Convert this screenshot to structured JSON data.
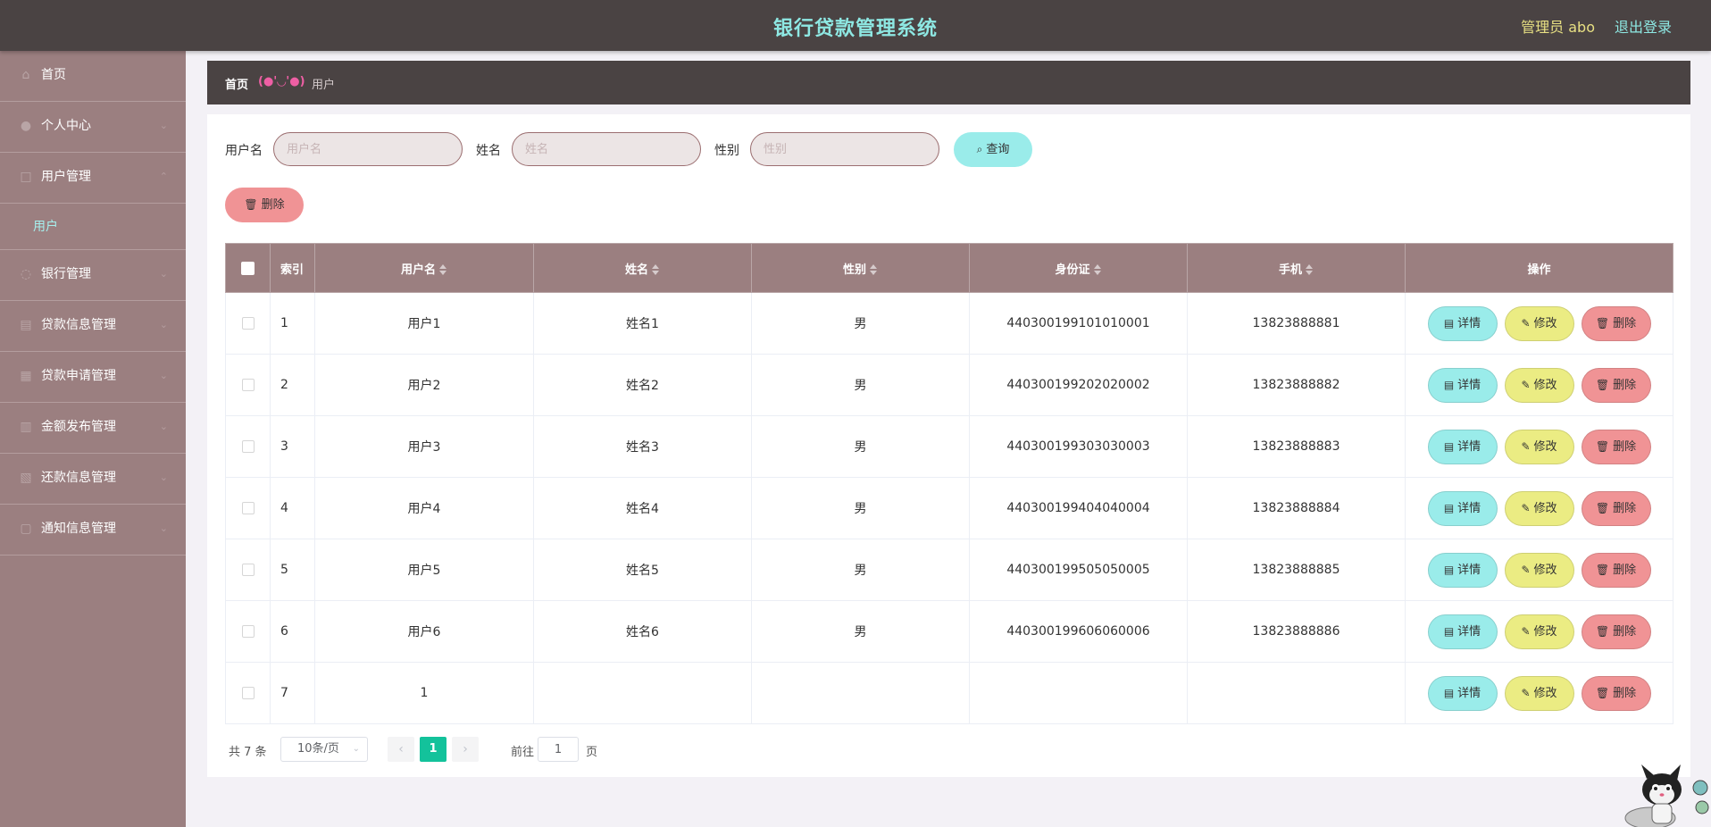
{
  "header": {
    "title": "银行贷款管理系统",
    "admin_label": "管理员 abo",
    "logout_label": "退出登录"
  },
  "sidebar": {
    "items": [
      {
        "label": "首页",
        "icon": "home-icon",
        "expandable": false
      },
      {
        "label": "个人中心",
        "icon": "user-icon",
        "expandable": true
      },
      {
        "label": "用户管理",
        "icon": "users-icon",
        "expandable": true
      },
      {
        "label": "银行管理",
        "icon": "bank-icon",
        "expandable": true
      },
      {
        "label": "贷款信息管理",
        "icon": "document-icon",
        "expandable": true
      },
      {
        "label": "贷款申请管理",
        "icon": "application-icon",
        "expandable": true
      },
      {
        "label": "金额发布管理",
        "icon": "money-icon",
        "expandable": true
      },
      {
        "label": "还款信息管理",
        "icon": "repayment-icon",
        "expandable": true
      },
      {
        "label": "通知信息管理",
        "icon": "notice-icon",
        "expandable": true
      }
    ],
    "submenu": {
      "label": "用户"
    }
  },
  "breadcrumb": {
    "home": "首页",
    "separator": "(●'◡'●)",
    "current": "用户"
  },
  "filters": [
    {
      "label": "用户名",
      "placeholder": "用户名",
      "value": ""
    },
    {
      "label": "姓名",
      "placeholder": "姓名",
      "value": ""
    },
    {
      "label": "性别",
      "placeholder": "性别",
      "value": ""
    }
  ],
  "buttons": {
    "query": "查询",
    "bulk_delete": "删除"
  },
  "table": {
    "columns": [
      "索引",
      "用户名",
      "姓名",
      "性别",
      "身份证",
      "手机",
      "操作"
    ],
    "rows": [
      {
        "index": "1",
        "username": "用户1",
        "name": "姓名1",
        "gender": "男",
        "id_card": "440300199101010001",
        "phone": "13823888881"
      },
      {
        "index": "2",
        "username": "用户2",
        "name": "姓名2",
        "gender": "男",
        "id_card": "440300199202020002",
        "phone": "13823888882"
      },
      {
        "index": "3",
        "username": "用户3",
        "name": "姓名3",
        "gender": "男",
        "id_card": "440300199303030003",
        "phone": "13823888883"
      },
      {
        "index": "4",
        "username": "用户4",
        "name": "姓名4",
        "gender": "男",
        "id_card": "440300199404040004",
        "phone": "13823888884"
      },
      {
        "index": "5",
        "username": "用户5",
        "name": "姓名5",
        "gender": "男",
        "id_card": "440300199505050005",
        "phone": "13823888885"
      },
      {
        "index": "6",
        "username": "用户6",
        "name": "姓名6",
        "gender": "男",
        "id_card": "440300199606060006",
        "phone": "13823888886"
      },
      {
        "index": "7",
        "username": "1",
        "name": "",
        "gender": "",
        "id_card": "",
        "phone": ""
      }
    ],
    "actions": {
      "detail": "详情",
      "edit": "修改",
      "delete": "删除"
    }
  },
  "pagination": {
    "total": "共 7 条",
    "page_size": "10条/页",
    "current_page": "1",
    "goto_label": "前往",
    "goto_value": "1",
    "page_unit": "页"
  },
  "colors": {
    "header_bg": "#4a4343",
    "title": "#8ee8e3",
    "admin": "#e8e083",
    "sidebar_bg": "#9b7f80",
    "submenu_active": "#a6f0ee",
    "table_header_bg": "#9b7f80",
    "detail_button": "#9aecea",
    "edit_button": "#ebec83",
    "delete_button": "#f09395",
    "page_active": "#13c29b"
  }
}
